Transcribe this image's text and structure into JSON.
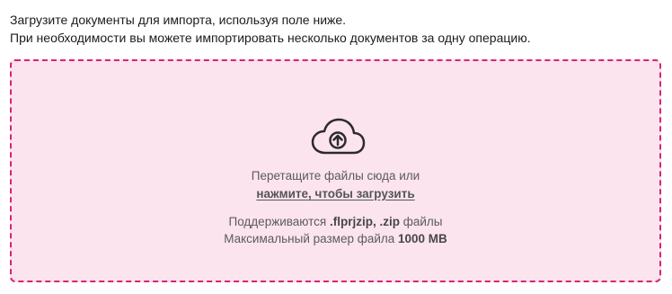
{
  "intro": {
    "line1": "Загрузите документы для импорта, используя поле ниже.",
    "line2": "При необходимости вы можете импортировать несколько документов за одну операцию."
  },
  "dropzone": {
    "icon": "cloud-upload-icon",
    "drag_text": "Перетащите файлы сюда или",
    "click_text": "нажмите, чтобы загрузить",
    "supported_prefix": "Поддерживаются ",
    "supported_formats": ".flprjzip, .zip",
    "supported_suffix": " файлы",
    "max_size_prefix": "Максимальный размер файла ",
    "max_size_value": "1000 MB"
  },
  "colors": {
    "accent": "#d8246f",
    "dropzone_background": "#fce4ee",
    "text": "#1b1b1b",
    "muted_text": "#5b5b5b"
  }
}
